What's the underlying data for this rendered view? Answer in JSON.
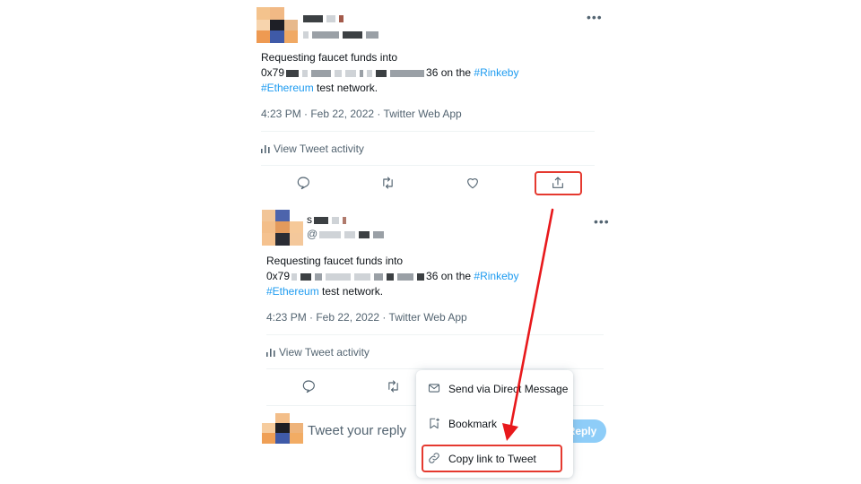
{
  "tweet1": {
    "text_line1": "Requesting faucet funds into",
    "addr_prefix": "0x79",
    "addr_suffix": "36 on the",
    "hashtag1": "#Rinkeby",
    "hashtag2": "#Ethereum",
    "text_tail": "test network.",
    "meta": "4:23 PM · Feb 22, 2022 · Twitter Web App",
    "activity_label": "View Tweet activity"
  },
  "tweet2": {
    "name_prefix": "s",
    "handle_prefix": "@",
    "text_line1": "Requesting faucet funds into",
    "addr_prefix": "0x79",
    "addr_suffix": "36 on the",
    "hashtag1": "#Rinkeby",
    "hashtag2": "#Ethereum",
    "text_tail": "test network.",
    "meta": "4:23 PM · Feb 22, 2022 · Twitter Web App",
    "activity_label": "View Tweet activity"
  },
  "share_menu": {
    "items": [
      {
        "label": "Send via Direct Message",
        "icon": "envelope-icon"
      },
      {
        "label": "Bookmark",
        "icon": "bookmark-add-icon"
      },
      {
        "label": "Copy link to Tweet",
        "icon": "link-icon"
      }
    ]
  },
  "reply_box": {
    "placeholder": "Tweet your reply",
    "button_label": "Reply"
  },
  "colors": {
    "link": "#1d9bf0",
    "highlight": "#e5392f",
    "arrow": "#e8191c",
    "reply_button": "#8ecdf8"
  }
}
